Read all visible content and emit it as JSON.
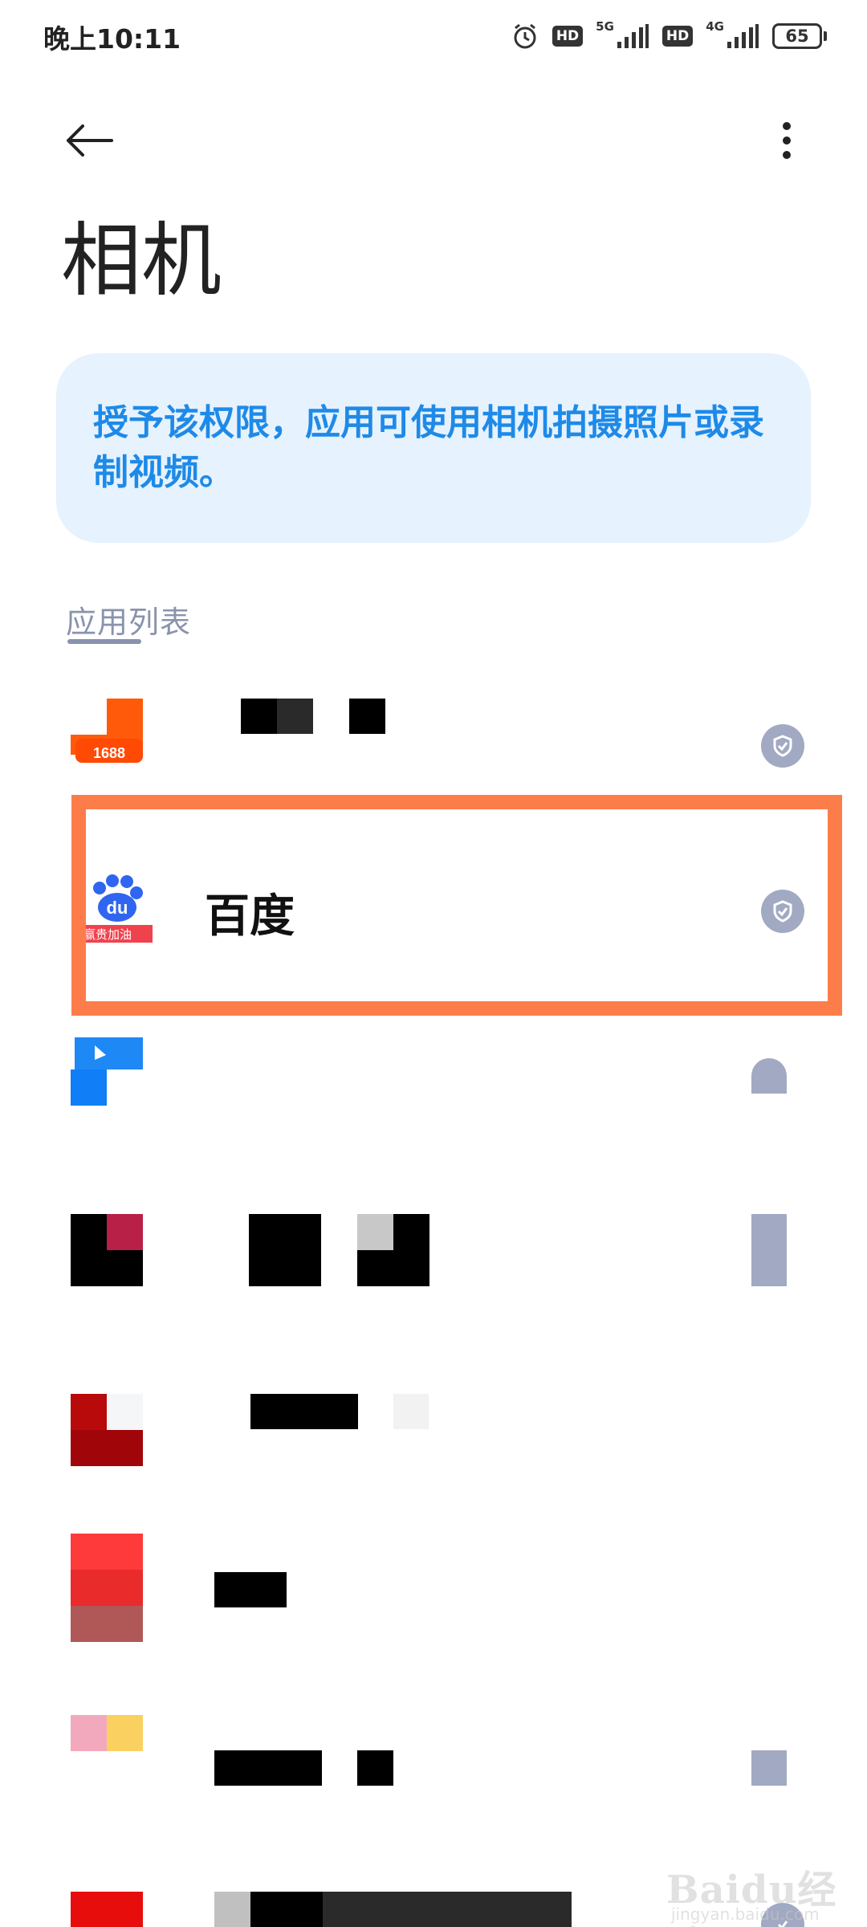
{
  "status_bar": {
    "time": "晚上10:11",
    "alarm_icon": "alarm-icon",
    "hd1": "HD",
    "net1": "5G",
    "hd2": "HD",
    "net2": "4G",
    "battery": "65"
  },
  "header": {
    "back_icon": "arrow-left-icon",
    "more_icon": "more-vertical-icon",
    "title": "相机"
  },
  "info_card": {
    "text": "授予该权限，应用可使用相机拍摄照片或录制视频。"
  },
  "section": {
    "title": "应用列表"
  },
  "apps": [
    {
      "name": "",
      "icon": "app-1688-icon",
      "icon_label": "1688",
      "status": "allowed"
    },
    {
      "name": "百度",
      "icon": "baidu-icon",
      "icon_label": "du",
      "icon_sub": "赢贵加油",
      "status": "allowed",
      "highlighted": true
    },
    {
      "name": "",
      "icon": "blue-app-icon",
      "status": "partial"
    },
    {
      "name": "",
      "icon": "red-app-icon",
      "status": "partial"
    },
    {
      "name": "",
      "icon": "red-a-app-icon",
      "status": "none"
    },
    {
      "name": "",
      "icon": "red-app-icon-2",
      "status": "none"
    },
    {
      "name": "",
      "icon": "pink-yellow-app-icon",
      "status": "partial"
    },
    {
      "name": "",
      "icon": "red-app-icon-3",
      "status": "allowed"
    }
  ],
  "colors": {
    "accent_blue": "#1e8ae8",
    "card_bg": "#e6f2fd",
    "highlight": "#fd7d4a",
    "check_gray": "#a2a9c2"
  },
  "watermark": {
    "text": "Baidu经验",
    "sub": "jingyan.baidu.com"
  }
}
